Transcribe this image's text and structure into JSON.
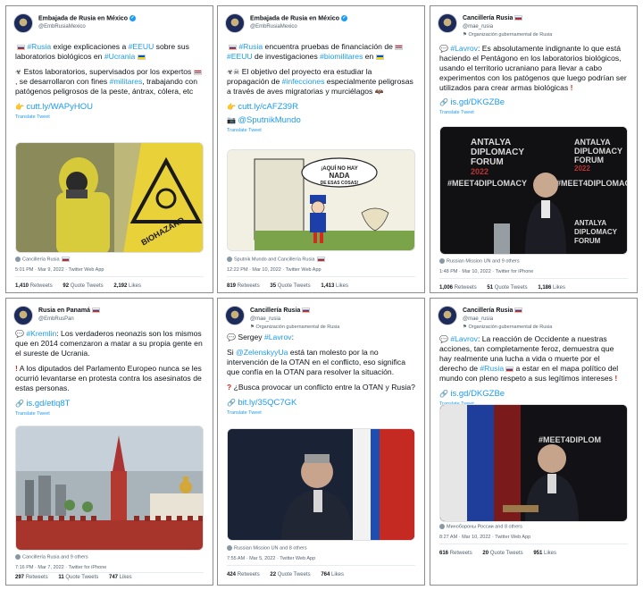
{
  "tweets": [
    {
      "name": "Embajada de Rusia en México",
      "handle": "@EmbRusiaMexico",
      "text": [
        {
          "t": "#Rusia",
          "tag": true
        },
        {
          "t": " exige explicaciones a "
        },
        {
          "t": "#EEUU",
          "tag": true
        },
        {
          "t": " sobre sus laboratorios biológicos en "
        },
        {
          "t": "#Ucrania",
          "tag": true
        }
      ],
      "text2": "Estos laboratorios, supervisados por los expertos , se desarrollaron con fines #militares, trabajando con patógenos peligrosos de la peste, ántrax, cólera, etc",
      "link": "cutt.ly/WAPyHOU",
      "translate": "Translate Tweet",
      "image_caption": "BIOHAZARD",
      "caption": "Cancillería Rusia",
      "meta": "5:01 PM · Mar 9, 2022 · Twitter Web App",
      "retweets": "1,410",
      "retweets_label": "Retweets",
      "quotes": "92",
      "quotes_label": "Quote Tweets",
      "likes": "2,192",
      "likes_label": "Likes"
    },
    {
      "name": "Embajada de Rusia en México",
      "handle": "@EmbRusiaMexico",
      "text": "#Rusia encuentra pruebas de financiación de #EEUU de investigaciones #biomilitares en",
      "text2": "El objetivo del proyecto era estudiar la propagación de #infecciones especialmente peligrosas a través de aves migratorias y murciélagos",
      "link": "cutt.ly/cAFZ39R",
      "link2": "@SputnikMundo",
      "translate": "Translate Tweet",
      "speech": "¡AQUÍ NO HAY NADA DE ESAS COSAS!",
      "caption": "Sputnik Mundo and Cancillería Rusia",
      "meta": "12:22 PM · Mar 10, 2022 · Twitter Web App",
      "retweets": "819",
      "retweets_label": "Retweets",
      "quotes": "35",
      "quotes_label": "Quote Tweets",
      "likes": "1,413",
      "likes_label": "Likes"
    },
    {
      "name": "Cancillería Rusia",
      "handle": "@mae_rusia",
      "gov": "Organización gubernamental de Rusia",
      "text": "#Lavrov: Es absolutamente indignante lo que está haciendo el Pentágono en los laboratorios biológicos, usando el territorio ucraniano para llevar a cabo experimentos con los patógenos que luego podrían ser utilizados para crear armas biológicas",
      "link": "is.gd/DKGZBe",
      "translate": "Translate Tweet",
      "banner": [
        "ANTALYA",
        "DIPLOMACY",
        "FORUM",
        "2022",
        "#MEET4DIPLOMACY"
      ],
      "caption": "Russian Mission UN and 9 others",
      "meta": "1:48 PM · Mar 10, 2022 · Twitter for iPhone",
      "retweets": "1,006",
      "retweets_label": "Retweets",
      "quotes": "51",
      "quotes_label": "Quote Tweets",
      "likes": "1,186",
      "likes_label": "Likes"
    },
    {
      "name": "Rusia en Panamá",
      "handle": "@EmbRusPan",
      "text": "#Kremlin: Los verdaderos neonazis son los mismos que en 2014 comenzaron a matar a su propia gente en el sureste de Ucrania.",
      "text2": "A los diputados del Parlamento Europeo nunca se les ocurrió levantarse en protesta contra los asesinatos de estas personas.",
      "link": "is.gd/etlq8T",
      "translate": "Translate Tweet",
      "caption": "Cancillería Rusia and 9 others",
      "meta": "7:16 PM · Mar 7, 2022 · Twitter for iPhone",
      "retweets": "297",
      "retweets_label": "Retweets",
      "quotes": "11",
      "quotes_label": "Quote Tweets",
      "likes": "747",
      "likes_label": "Likes"
    },
    {
      "name": "Cancillería Rusia",
      "handle": "@mae_rusia",
      "gov": "Organización gubernamental de Rusia",
      "text": "Sergey #Lavrov:",
      "text2": "Si @ZelenskyyUa está tan molesto por la no intervención de la OTAN en el conflicto, eso significa que confía en la OTAN para resolver la situación.",
      "text3": "¿Busca provocar un conflicto entre la OTAN y Rusia?",
      "link": "bit.ly/35QC7GK",
      "translate": "Translate Tweet",
      "caption": "Russian Mission UN and 8 others",
      "meta": "7:55 AM · Mar 5, 2022 · Twitter Web App",
      "retweets": "424",
      "retweets_label": "Retweets",
      "quotes": "22",
      "quotes_label": "Quote Tweets",
      "likes": "764",
      "likes_label": "Likes"
    },
    {
      "name": "Cancillería Rusia",
      "handle": "@mae_rusia",
      "gov": "Organización gubernamental de Rusia",
      "text": "#Lavrov: La reacción de Occidente a nuestras acciones, tan completamente feroz, demuestra que hay realmente una lucha a vida o muerte por el derecho de #Rusia a estar en el mapa político del mundo con pleno respeto a sus legítimos intereses",
      "link": "is.gd/DKGZBe",
      "translate": "Translate Tweet",
      "banner": "#MEET4DIPLOM",
      "caption": "Минобороны России and 8 others",
      "meta": "8:27 AM · Mar 10, 2022 · Twitter Web App",
      "retweets": "616",
      "retweets_label": "Retweets",
      "quotes": "20",
      "quotes_label": "Quote Tweets",
      "likes": "951",
      "likes_label": "Likes"
    }
  ],
  "colors": {
    "link": "#1d9bf0",
    "muted": "#536471",
    "text": "#0f1419"
  }
}
